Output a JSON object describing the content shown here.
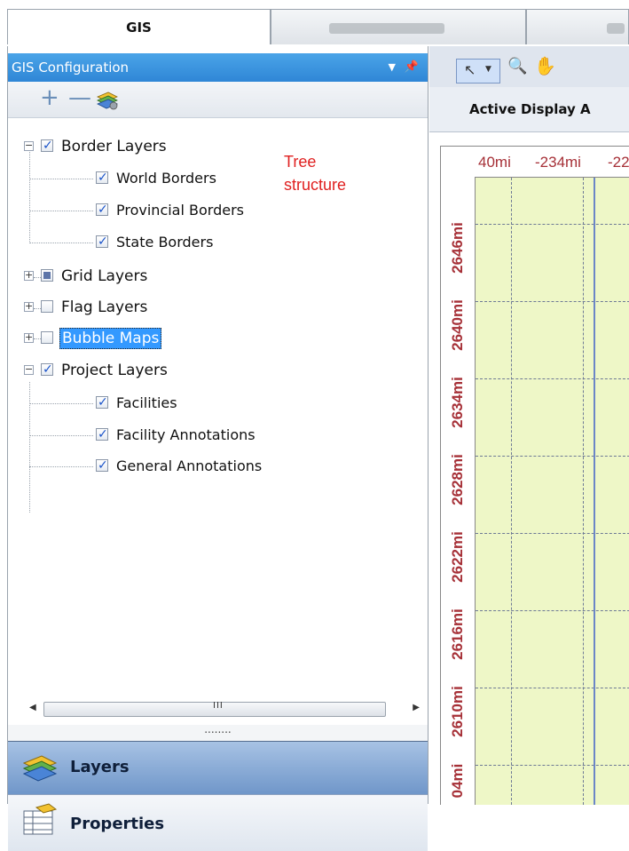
{
  "tabs": [
    {
      "label": "GIS"
    },
    {
      "label": ""
    },
    {
      "label": ""
    }
  ],
  "panel": {
    "title": "GIS Configuration",
    "toolbar": {
      "add_label": "+",
      "remove_label": "—"
    }
  },
  "tree": {
    "border_layers": {
      "label": "Border Layers",
      "checked": true
    },
    "world_borders": {
      "label": "World Borders",
      "checked": true
    },
    "provincial_borders": {
      "label": "Provincial Borders",
      "checked": true
    },
    "state_borders": {
      "label": "State Borders",
      "checked": true
    },
    "grid_layers": {
      "label": "Grid Layers",
      "state": "partial"
    },
    "flag_layers": {
      "label": "Flag Layers",
      "checked": false
    },
    "bubble_maps": {
      "label": "Bubble Maps",
      "checked": false,
      "selected": true
    },
    "project_layers": {
      "label": "Project Layers",
      "checked": true
    },
    "facilities": {
      "label": "Facilities",
      "checked": true
    },
    "facility_annotations": {
      "label": "Facility Annotations",
      "checked": true
    },
    "general_annotations": {
      "label": "General Annotations",
      "checked": true
    }
  },
  "annotation": {
    "line1": "Tree",
    "line2": "structure"
  },
  "scrollbar": {
    "grip": "III"
  },
  "splitter": {
    "grip": "........"
  },
  "nav": {
    "layers_label": "Layers",
    "properties_label": "Properties"
  },
  "map": {
    "header": "Active Display A",
    "x_labels": [
      "40mi",
      "-234mi",
      "-22"
    ],
    "y_labels": [
      "2646mi",
      "2640mi",
      "2634mi",
      "2628mi",
      "2622mi",
      "2616mi",
      "2610mi",
      "04mi"
    ]
  }
}
